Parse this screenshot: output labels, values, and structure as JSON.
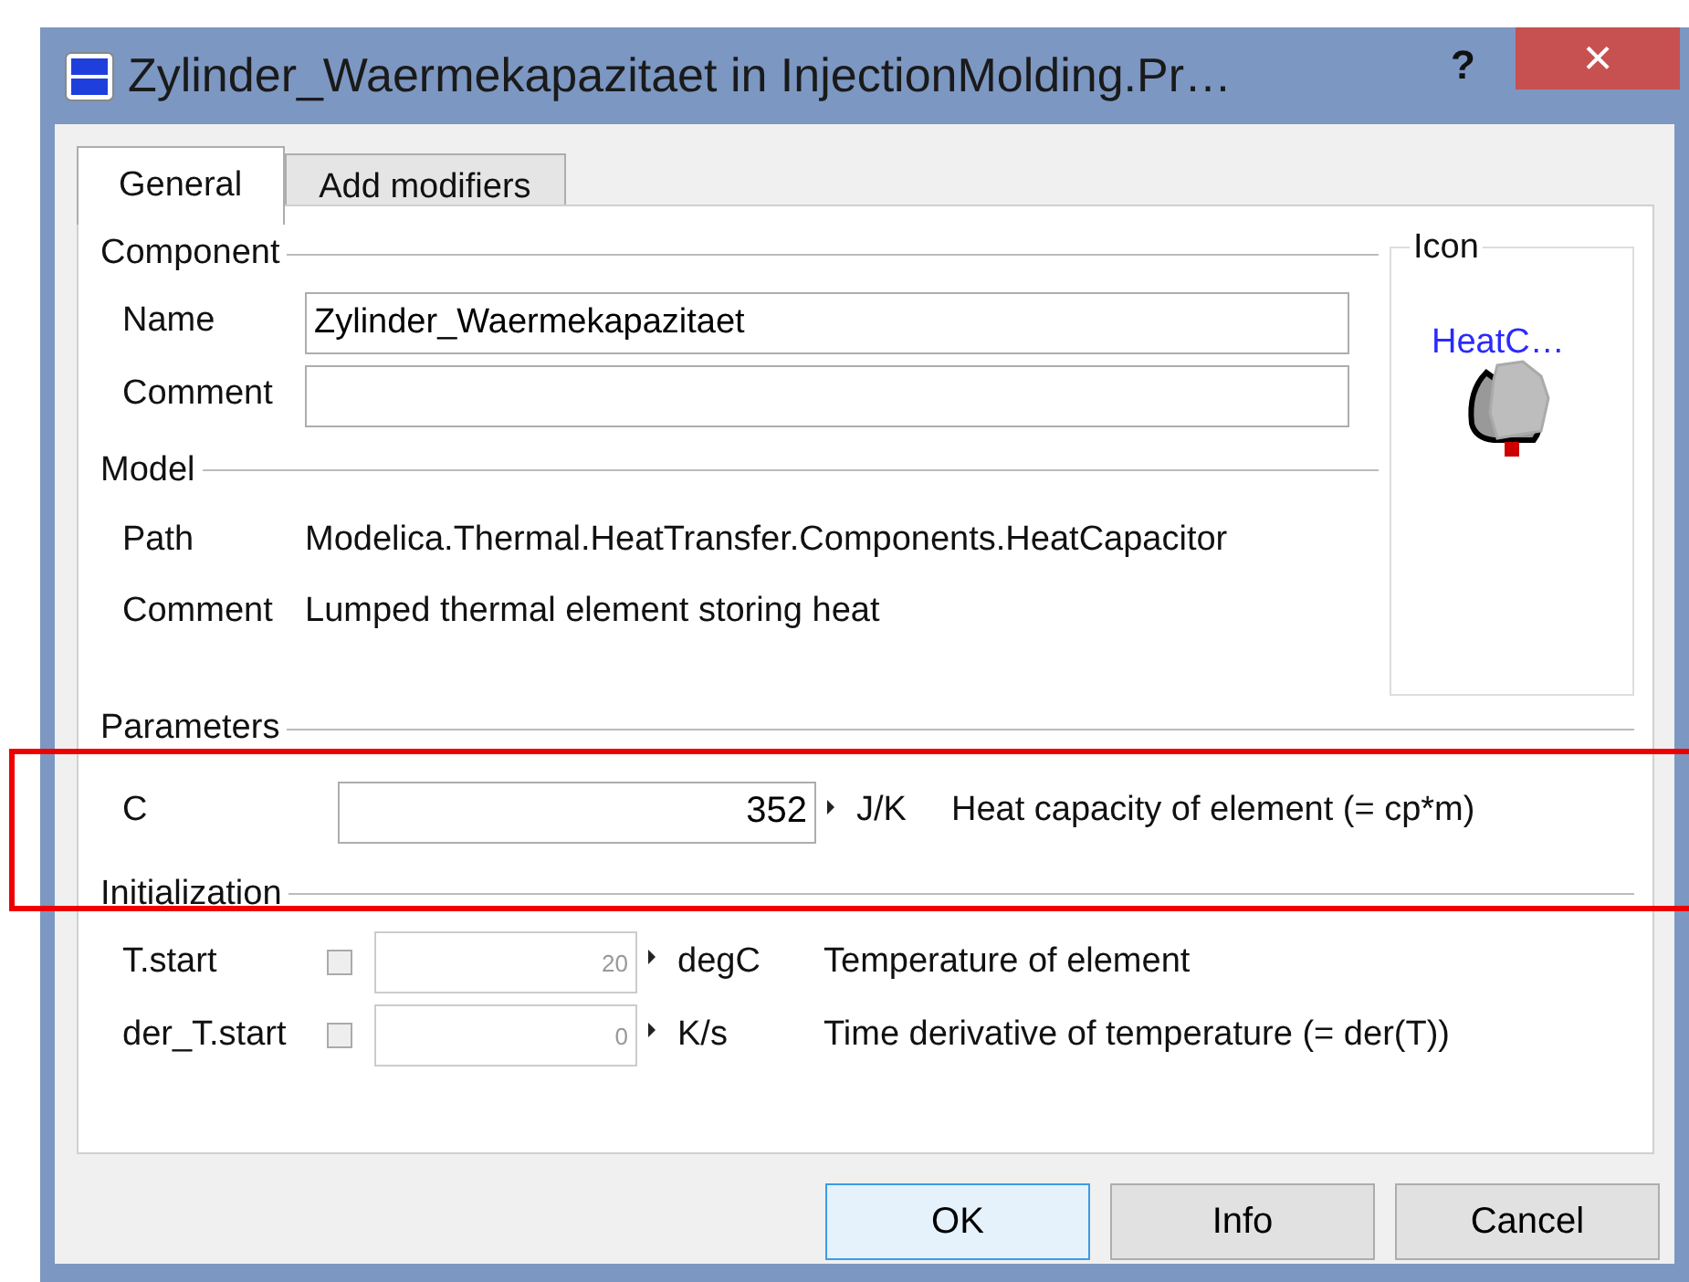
{
  "window": {
    "title": "Zylinder_Waermekapazitaet in InjectionMolding.Pr…",
    "help_button": "?",
    "close_button": "×"
  },
  "tabs": [
    {
      "label": "General",
      "selected": true
    },
    {
      "label": "Add modifiers",
      "selected": false
    }
  ],
  "component": {
    "heading": "Component",
    "fields": [
      {
        "label": "Name",
        "value": "Zylinder_Waermekapazitaet"
      },
      {
        "label": "Comment"
      }
    ]
  },
  "icon_panel": {
    "heading": "Icon",
    "label": "HeatC…"
  },
  "model": {
    "heading": "Model",
    "rows": [
      {
        "label": "Path",
        "value": "Modelica.Thermal.HeatTransfer.Components.HeatCapacitor"
      },
      {
        "label": "Comment",
        "value": "Lumped thermal element storing heat"
      }
    ]
  },
  "parameters": {
    "heading": "Parameters",
    "rows": [
      {
        "name": "C",
        "value": "352",
        "disabled": false,
        "unit": "J/K",
        "description": "Heat capacity of element (= cp*m)"
      }
    ]
  },
  "initialization": {
    "heading": "Initialization",
    "rows": [
      {
        "name": "T.start",
        "checked": false,
        "value": "20",
        "disabled": true,
        "unit": "degC",
        "description": "Temperature of element"
      },
      {
        "name": "der_T.start",
        "checked": false,
        "value": "0",
        "disabled": true,
        "unit": "K/s",
        "description": "Time derivative of temperature (= der(T))"
      }
    ]
  },
  "buttons": [
    {
      "label": "OK",
      "focused": true
    },
    {
      "label": "Info",
      "focused": false
    },
    {
      "label": "Cancel",
      "focused": false
    }
  ],
  "annotation": {
    "highlight": true
  }
}
